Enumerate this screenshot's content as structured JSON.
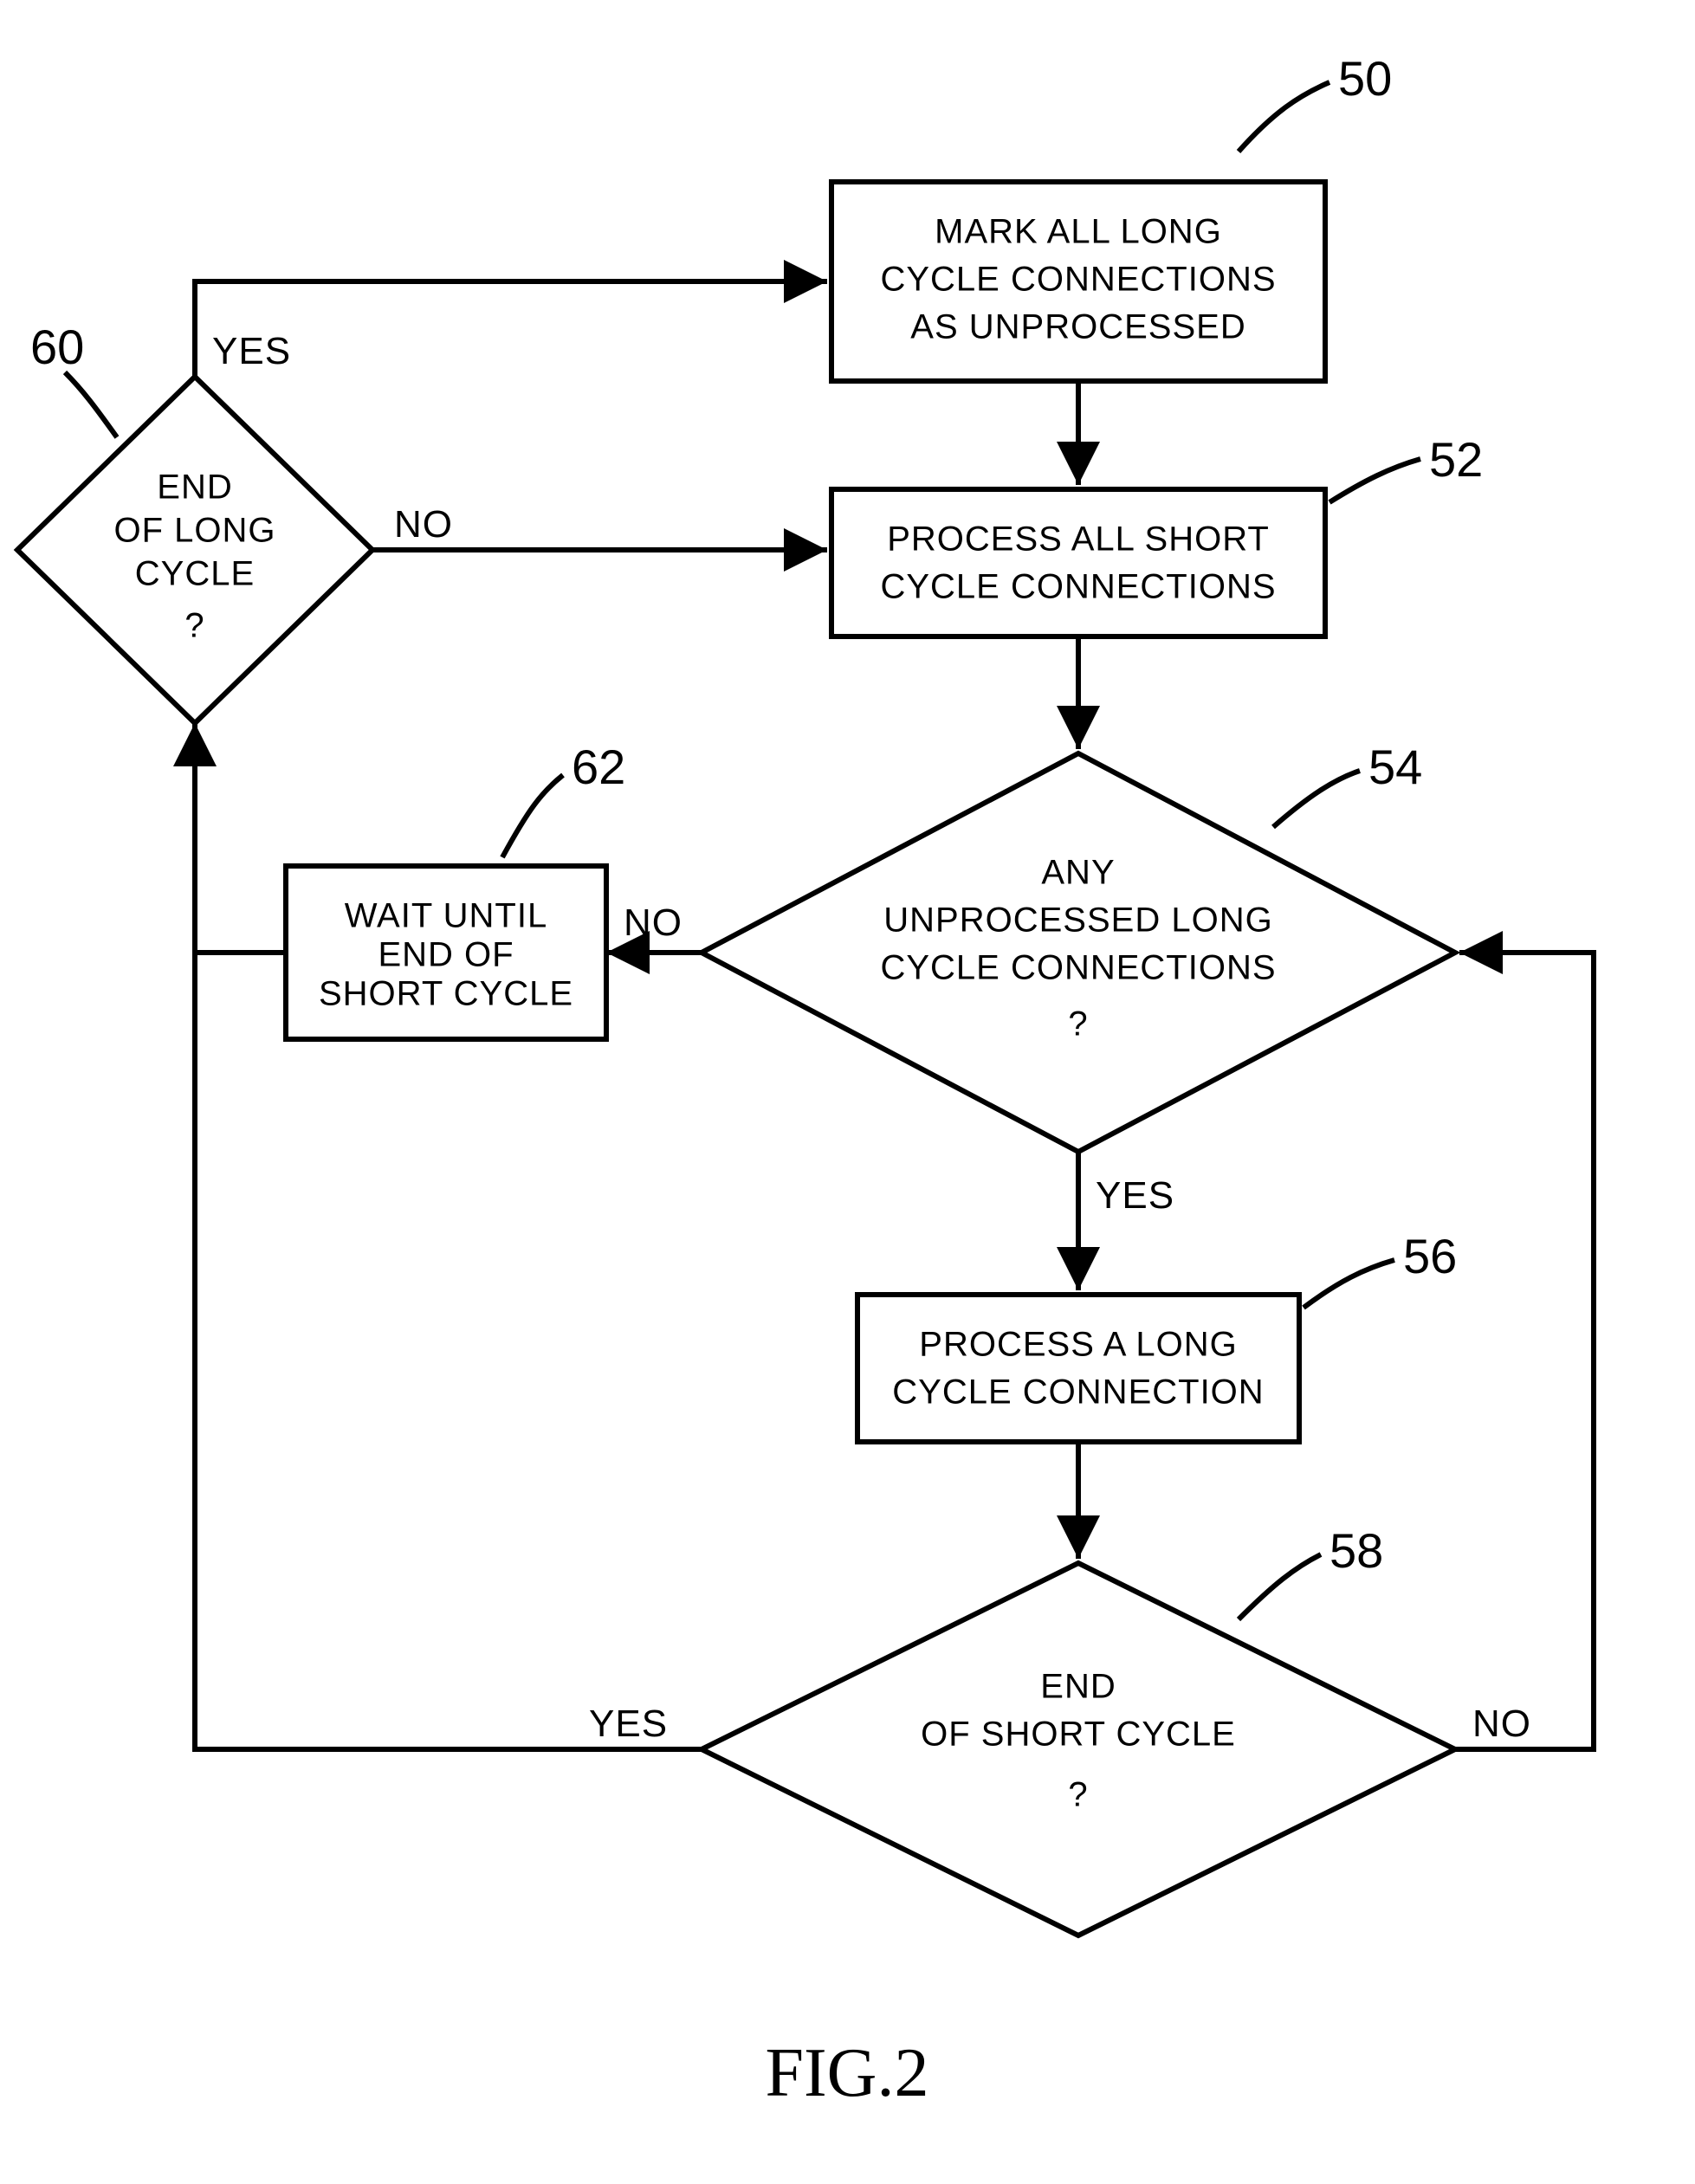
{
  "figure_label": "FIG.2",
  "nodes": {
    "n50": {
      "ref": "50",
      "lines": [
        "MARK ALL LONG",
        "CYCLE CONNECTIONS",
        "AS UNPROCESSED"
      ]
    },
    "n52": {
      "ref": "52",
      "lines": [
        "PROCESS ALL SHORT",
        "CYCLE CONNECTIONS"
      ]
    },
    "n54": {
      "ref": "54",
      "lines": [
        "ANY",
        "UNPROCESSED LONG",
        "CYCLE CONNECTIONS",
        "?"
      ]
    },
    "n56": {
      "ref": "56",
      "lines": [
        "PROCESS A LONG",
        "CYCLE CONNECTION"
      ]
    },
    "n58": {
      "ref": "58",
      "lines": [
        "END",
        "OF SHORT CYCLE",
        "?"
      ]
    },
    "n60": {
      "ref": "60",
      "lines": [
        "END",
        "OF LONG",
        "CYCLE",
        "?"
      ]
    },
    "n62": {
      "ref": "62",
      "lines": [
        "WAIT UNTIL",
        "END OF",
        "SHORT CYCLE"
      ]
    }
  },
  "edges": {
    "e60_yes": "YES",
    "e60_no": "NO",
    "e54_yes": "YES",
    "e54_no": "NO",
    "e58_yes": "YES",
    "e58_no": "NO"
  }
}
